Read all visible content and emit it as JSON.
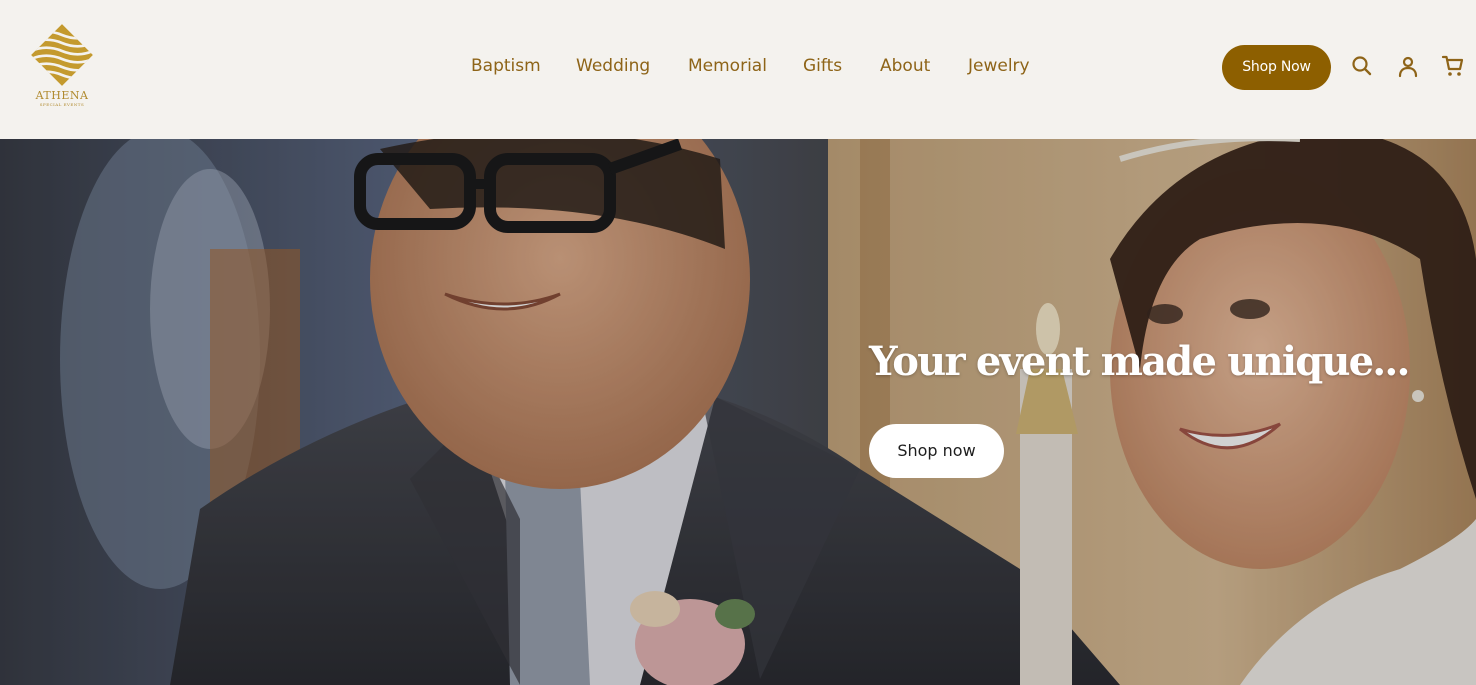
{
  "brand": {
    "name": "ATHENA",
    "tagline": "SPECIAL EVENTS",
    "color": "#b08a2e"
  },
  "nav": {
    "items": [
      {
        "label": "Baptism"
      },
      {
        "label": "Wedding"
      },
      {
        "label": "Memorial"
      },
      {
        "label": "Gifts"
      },
      {
        "label": "About"
      },
      {
        "label": "Jewelry"
      }
    ],
    "color": "#8e6418"
  },
  "header": {
    "shop_now_label": "Shop Now",
    "accent": "#8d5f00",
    "icons": [
      "search-icon",
      "account-icon",
      "cart-icon"
    ]
  },
  "hero": {
    "title": "Your event made unique...",
    "button_label": "Shop now",
    "image": "wedding-couple-photo"
  }
}
